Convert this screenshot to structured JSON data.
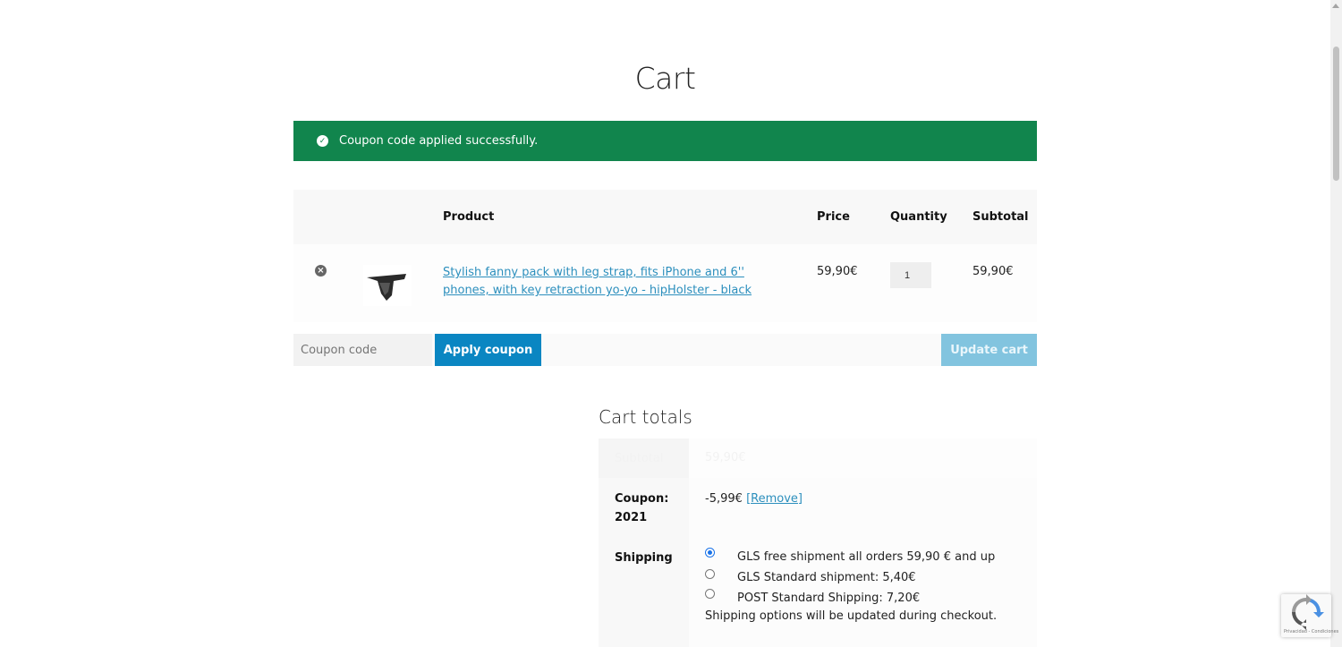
{
  "page": {
    "title": "Cart"
  },
  "notice": {
    "message": "Coupon code applied successfully.",
    "color": "#11854d"
  },
  "cart_table": {
    "headers": {
      "product": "Product",
      "price": "Price",
      "quantity": "Quantity",
      "subtotal": "Subtotal"
    },
    "rows": [
      {
        "product_name": "Stylish fanny pack with leg strap, fits iPhone and 6'' phones, with key retraction yo-yo - hipHolster - black",
        "price": "59,90€",
        "quantity": "1",
        "subtotal": "59,90€"
      }
    ]
  },
  "actions": {
    "coupon_placeholder": "Coupon code",
    "apply_label": "Apply coupon",
    "update_label": "Update cart"
  },
  "totals": {
    "title": "Cart totals",
    "subtotal_label": "Subtotal",
    "subtotal_value": "59,90€",
    "coupon_label_line1": "Coupon:",
    "coupon_label_line2": "2021",
    "coupon_value": "-5,99€",
    "coupon_remove": "[Remove]",
    "shipping_label": "Shipping",
    "shipping_options": [
      {
        "label": "GLS free shipment all orders 59,90 € and up",
        "selected": true
      },
      {
        "label": "GLS Standard shipment: 5,40€",
        "selected": false
      },
      {
        "label": "POST Standard Shipping: 7,20€",
        "selected": false
      }
    ],
    "shipping_note": "Shipping options will be updated during checkout."
  },
  "recaptcha": {
    "footer": "Privacidad - Condiciones"
  },
  "colors": {
    "accent": "#0a86c2",
    "link": "#2c8fbd",
    "update_disabled": "#82c4df"
  }
}
